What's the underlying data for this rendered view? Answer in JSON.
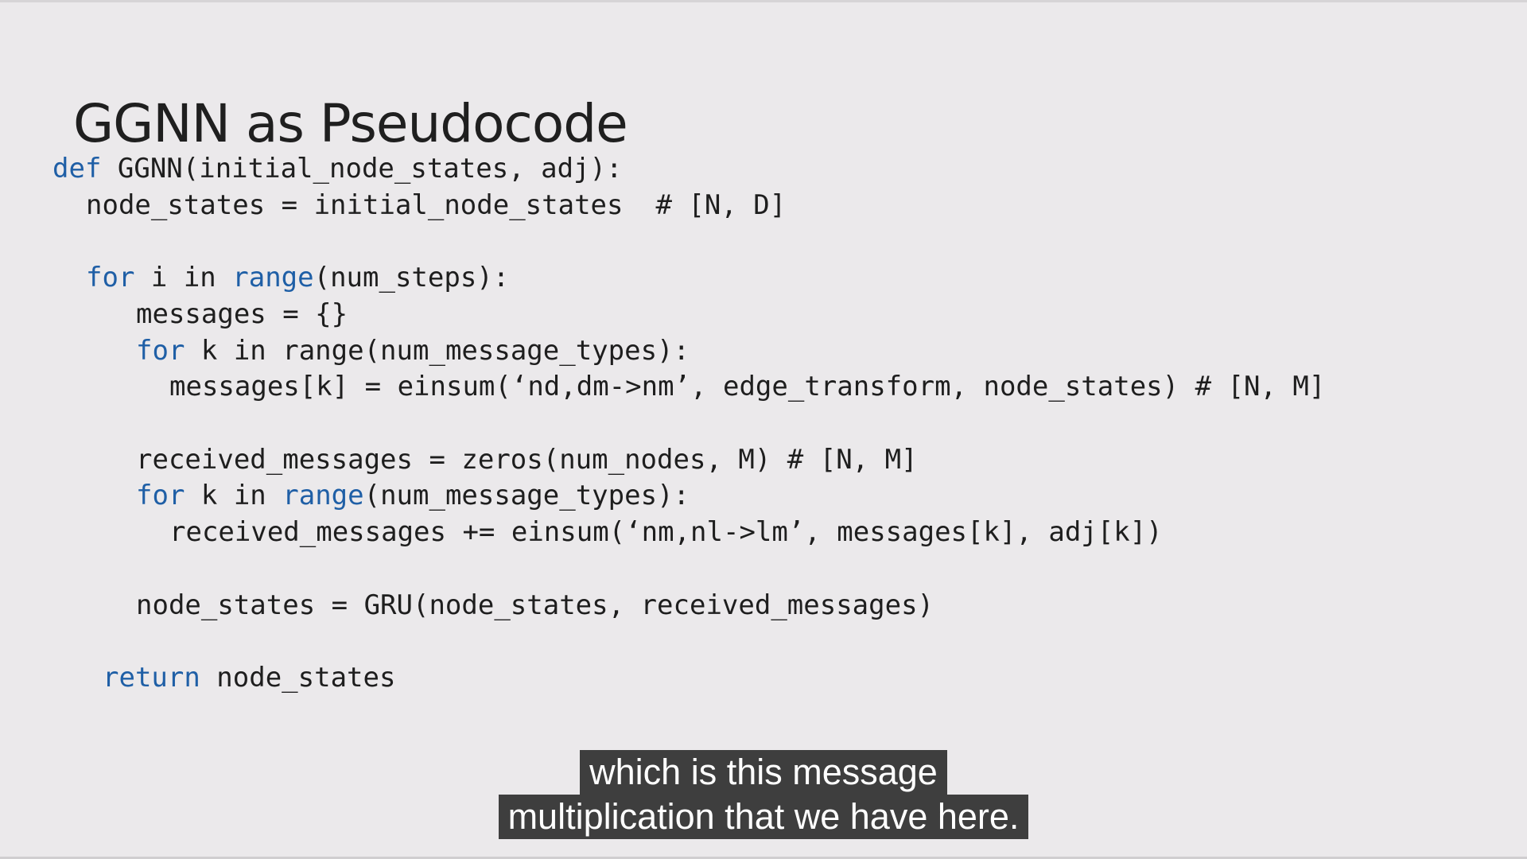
{
  "slide": {
    "title": "GGNN as Pseudocode"
  },
  "code": {
    "lines": [
      {
        "indent": "",
        "parts": [
          {
            "t": "def",
            "k": true
          },
          {
            "t": " GGNN(initial_node_states, adj):"
          }
        ]
      },
      {
        "indent": " ",
        "parts": [
          {
            "t": "node_states = initial_node_states  # [N, D]"
          }
        ]
      },
      {
        "indent": "",
        "parts": []
      },
      {
        "indent": " ",
        "parts": [
          {
            "t": "for",
            "k": true
          },
          {
            "t": " i in "
          },
          {
            "t": "range",
            "k": true
          },
          {
            "t": "(num_steps):"
          }
        ]
      },
      {
        "indent": "  ",
        "parts": [
          {
            "t": "messages = {}"
          }
        ]
      },
      {
        "indent": "  ",
        "parts": [
          {
            "t": "for",
            "k": true
          },
          {
            "t": " k in range(num_message_types):"
          }
        ]
      },
      {
        "indent": "   ",
        "parts": [
          {
            "t": "messages[k] = einsum(‘nd,dm->nm’, edge_transform, node_states) # [N, M]"
          }
        ]
      },
      {
        "indent": "",
        "parts": []
      },
      {
        "indent": "  ",
        "parts": [
          {
            "t": "received_messages = zeros(num_nodes, M) # [N, M]"
          }
        ]
      },
      {
        "indent": "  ",
        "parts": [
          {
            "t": "for",
            "k": true
          },
          {
            "t": " k in "
          },
          {
            "t": "range",
            "k": true
          },
          {
            "t": "(num_message_types):"
          }
        ]
      },
      {
        "indent": "   ",
        "parts": [
          {
            "t": "received_messages += einsum(‘nm,nl->lm’, messages[k], adj[k])"
          }
        ]
      },
      {
        "indent": "",
        "parts": []
      },
      {
        "indent": "  ",
        "parts": [
          {
            "t": "node_states = GRU(node_states, received_messages)"
          }
        ]
      },
      {
        "indent": "",
        "parts": []
      },
      {
        "indent": " ",
        "parts": [
          {
            "t": "return",
            "k": true
          },
          {
            "t": " node_states"
          }
        ]
      }
    ]
  },
  "captions": {
    "lines": [
      "which is this message",
      "multiplication that we have here."
    ]
  },
  "colors": {
    "background": "#ebe9eb",
    "text": "#1e1e1e",
    "keyword": "#1f5fa6",
    "caption_bg": "#262626",
    "caption_text": "#ffffff"
  }
}
